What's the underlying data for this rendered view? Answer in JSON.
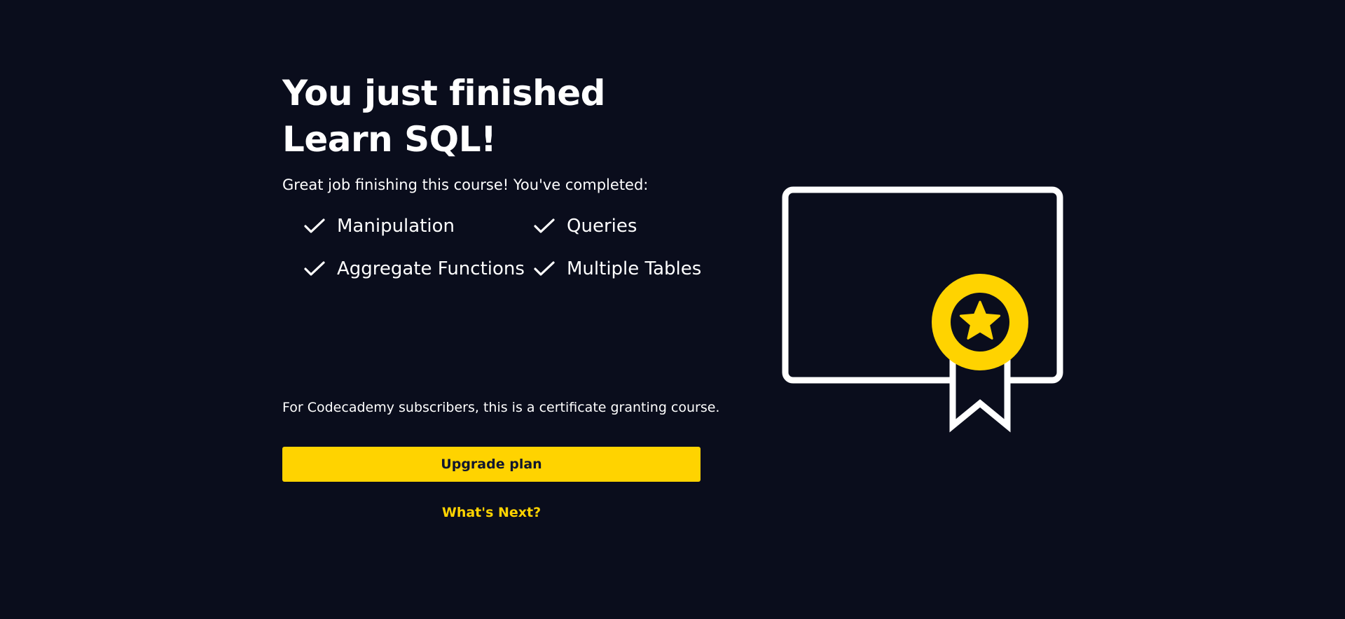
{
  "heading": {
    "line1": "You just finished",
    "line2": "Learn SQL!"
  },
  "subtitle": "Great job finishing this course! You've completed:",
  "modules": [
    {
      "label": "Manipulation",
      "icon": "check-icon"
    },
    {
      "label": "Queries",
      "icon": "check-icon"
    },
    {
      "label": "Aggregate Functions",
      "icon": "check-icon"
    },
    {
      "label": "Multiple Tables",
      "icon": "check-icon"
    }
  ],
  "note": "For Codecademy subscribers, this is a certificate granting course.",
  "actions": {
    "upgrade_label": "Upgrade plan",
    "next_label": "What's Next?"
  },
  "illustration": {
    "icon": "certificate-icon",
    "badge_icon": "star-icon"
  },
  "colors": {
    "background": "#0a0d1c",
    "accent": "#ffd300",
    "text": "#ffffff",
    "button_text": "#10162f"
  }
}
